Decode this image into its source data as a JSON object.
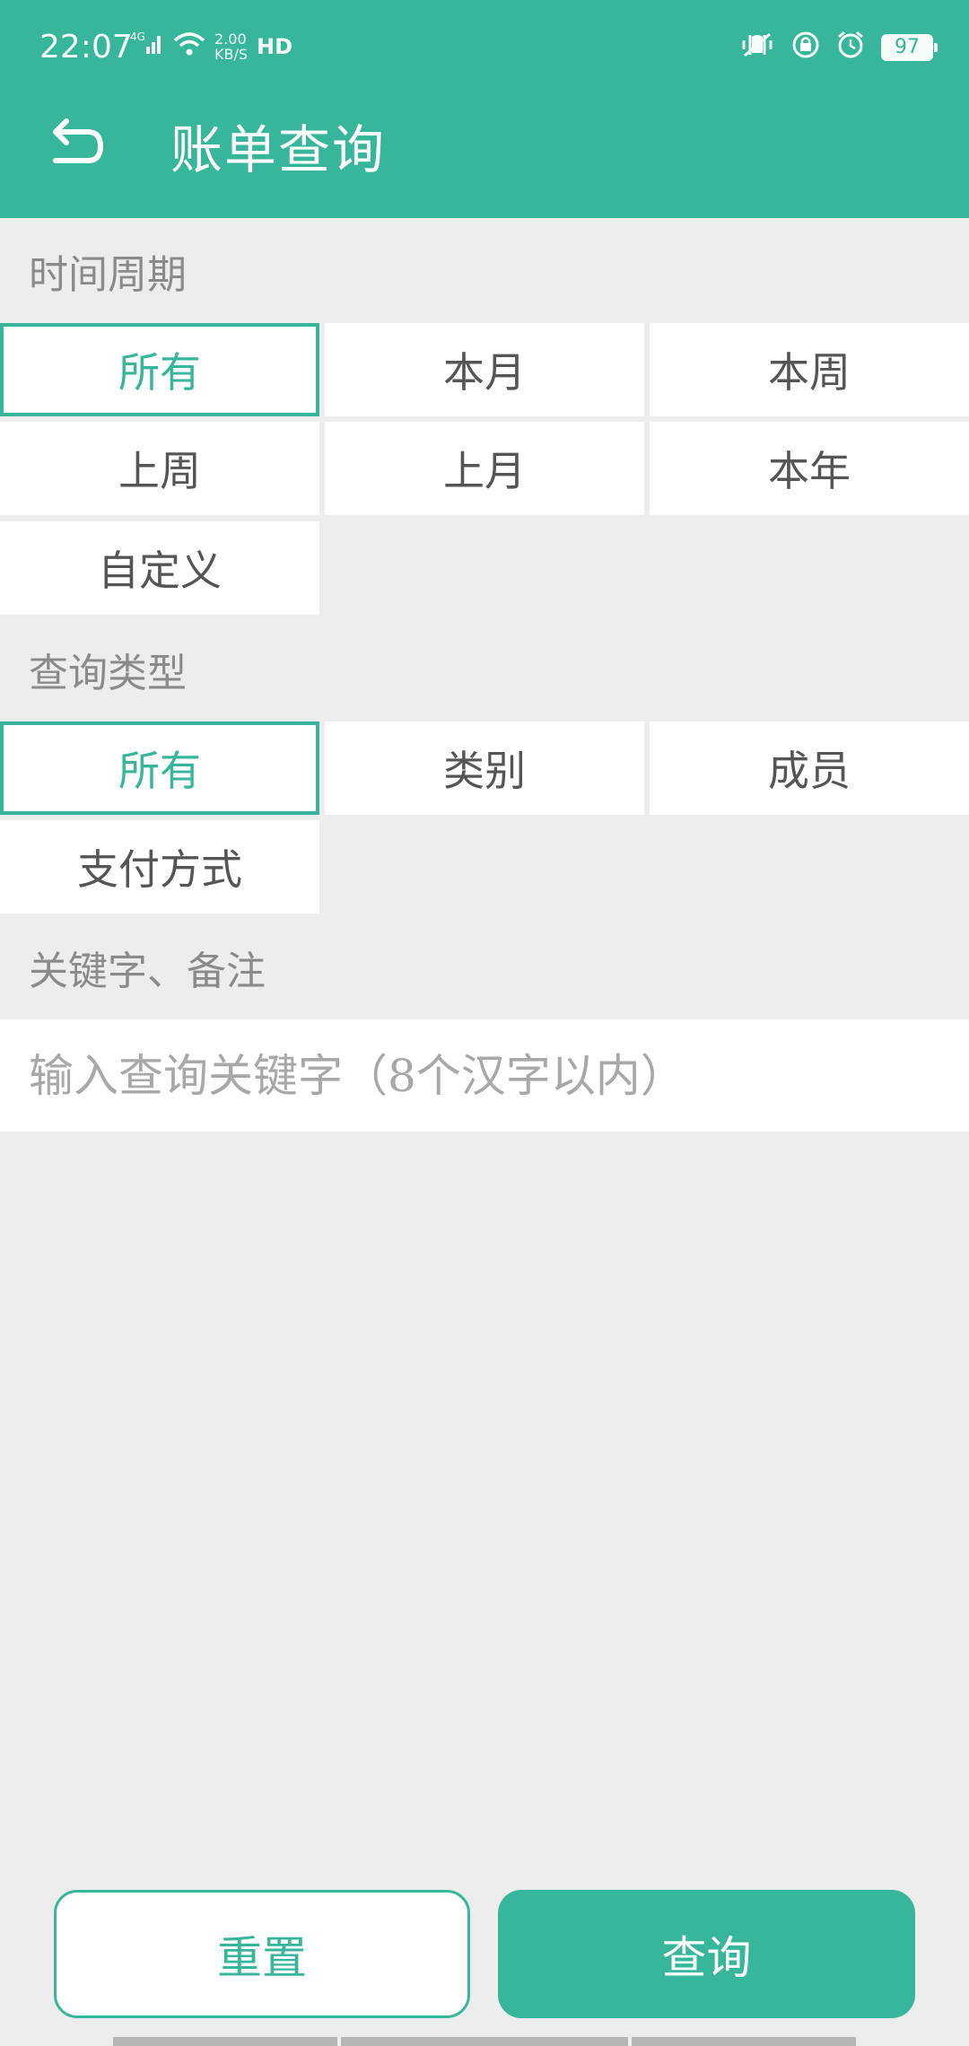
{
  "status_bar": {
    "time": "22:07",
    "network": "4G",
    "speed_top": "2.00",
    "speed_bottom": "KB/S",
    "hd": "HD",
    "battery": "97"
  },
  "header": {
    "title": "账单查询"
  },
  "time_period": {
    "label": "时间周期",
    "options": [
      "所有",
      "本月",
      "本周",
      "上周",
      "上月",
      "本年",
      "自定义"
    ],
    "selected": "所有"
  },
  "query_type": {
    "label": "查询类型",
    "options": [
      "所有",
      "类别",
      "成员",
      "支付方式"
    ],
    "selected": "所有"
  },
  "keyword": {
    "label": "关键字、备注",
    "placeholder": "输入查询关键字（8个汉字以内）",
    "value": ""
  },
  "actions": {
    "reset_label": "重置",
    "query_label": "查询"
  },
  "colors": {
    "accent": "#37b69b",
    "background": "#ededed"
  }
}
